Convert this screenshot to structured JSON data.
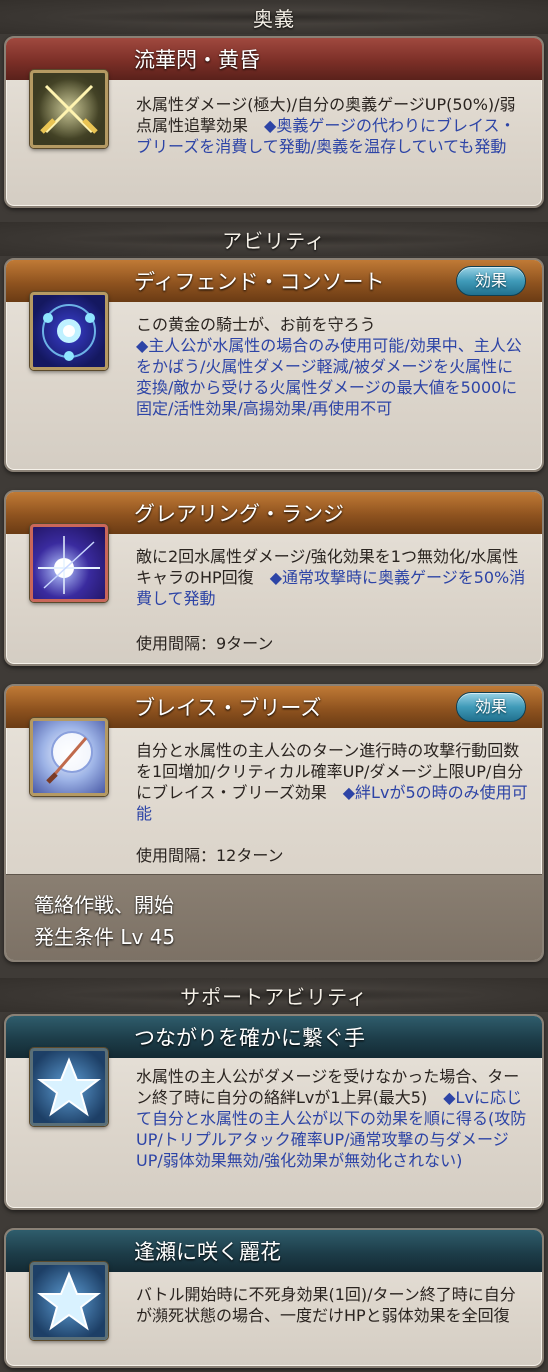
{
  "sections": {
    "ougi": "奥義",
    "abilities": "アビリティ",
    "support": "サポートアビリティ"
  },
  "ougi": {
    "name": "流華閃・黄昏",
    "icon": "crossed-swords-icon",
    "desc_plain": "水属性ダメージ(極大)/自分の奥義ゲージUP(50%)/弱点属性追撃効果",
    "desc_note": "◆奥義ゲージの代わりにブレイス・ブリーズを消費して発動/奥義を温存していても発動"
  },
  "abilities": [
    {
      "name": "ディフェンド・コンソート",
      "effect_label": "効果",
      "icon": "blue-shield-orb-icon",
      "desc_plain": "この黄金の騎士が、お前を守ろう",
      "desc_note": "◆主人公が水属性の場合のみ使用可能/効果中、主人公をかばう/火属性ダメージ軽減/被ダメージを火属性に変換/敵から受ける火属性ダメージの最大値を5000に固定/活性効果/高揚効果/再使用不可"
    },
    {
      "name": "グレアリング・ランジ",
      "icon": "light-burst-icon",
      "desc_plain": "敵に2回水属性ダメージ/強化効果を1つ無効化/水属性キャラのHP回復",
      "desc_note": "◆通常攻撃時に奥義ゲージを50%消費して発動",
      "cooldown": "使用間隔：9ターン"
    },
    {
      "name": "ブレイス・ブリーズ",
      "effect_label": "効果",
      "icon": "rapier-orb-icon",
      "desc_plain": "自分と水属性の主人公のターン進行時の攻撃行動回数を1回増加/クリティカル確率UP/ダメージ上限UP/自分にブレイス・ブリーズ効果",
      "desc_note": "◆絆Lvが5の時のみ使用可能",
      "cooldown": "使用間隔：12ターン",
      "unlock_title": "篭絡作戦、開始",
      "unlock_condition": "発生条件 Lv 45"
    }
  ],
  "support": [
    {
      "name": "つながりを確かに繋ぐ手",
      "icon": "star-icon",
      "desc_plain": "水属性の主人公がダメージを受けなかった場合、ターン終了時に自分の絡絆Lvが1上昇(最大5)",
      "desc_note": "◆Lvに応じて自分と水属性の主人公が以下の効果を順に得る(攻防UP/トリプルアタック確率UP/通常攻撃の与ダメージUP/弱体効果無効/強化効果が無効化されない)"
    },
    {
      "name": "逢瀬に咲く麗花",
      "icon": "star-icon",
      "desc_plain": "バトル開始時に不死身効果(1回)/ターン終了時に自分が瀕死状態の場合、一度だけHPと弱体効果を全回復"
    }
  ]
}
